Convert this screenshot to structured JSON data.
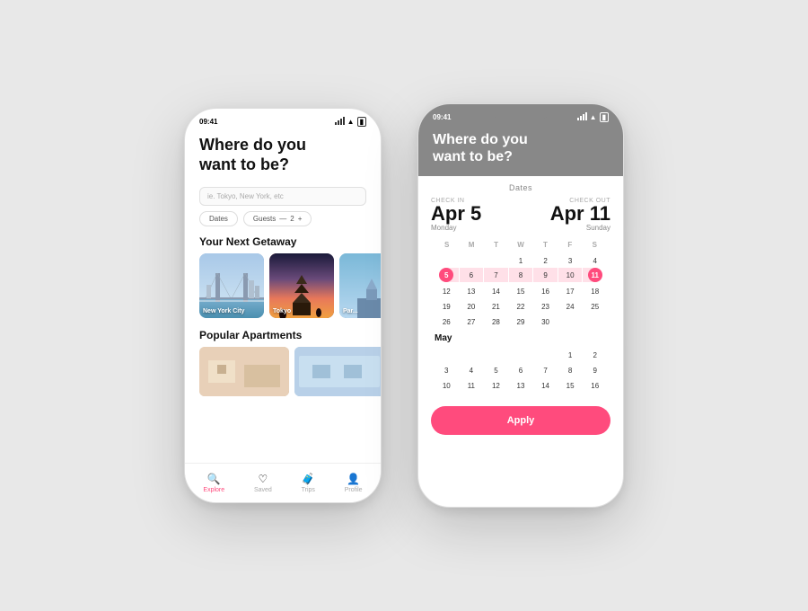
{
  "phones": {
    "left": {
      "status": {
        "time": "09:41",
        "signal": "signal-icon",
        "wifi": "wifi-icon",
        "battery": "battery-icon"
      },
      "header": {
        "title": "Where do you\nwant to be?"
      },
      "search": {
        "placeholder": "ie. Tokyo, New York, etc"
      },
      "filters": {
        "dates_label": "Dates",
        "guests_label": "Guests",
        "guests_value": "2",
        "guests_minus": "−",
        "guests_plus": "+"
      },
      "getaway": {
        "section_title": "Your Next Getaway",
        "cards": [
          {
            "label": "New York City",
            "style": "nyc"
          },
          {
            "label": "Tokyo",
            "style": "tokyo"
          },
          {
            "label": "Par...",
            "style": "paris"
          }
        ]
      },
      "apartments": {
        "section_title": "Popular Apartments"
      },
      "nav": {
        "items": [
          {
            "icon": "🔍",
            "label": "Explore",
            "active": true
          },
          {
            "icon": "♡",
            "label": "Saved",
            "active": false
          },
          {
            "icon": "🧳",
            "label": "Trips",
            "active": false
          },
          {
            "icon": "👤",
            "label": "Profile",
            "active": false
          }
        ]
      }
    },
    "right": {
      "status": {
        "time": "09:41"
      },
      "header": {
        "title": "Where do you\nwant to be?"
      },
      "dates_panel": {
        "title": "Dates",
        "checkin_label": "CHECK IN",
        "checkin_date": "Apr 5",
        "checkin_day": "Monday",
        "checkout_label": "CHECK OUT",
        "checkout_date": "Apr 11",
        "checkout_day": "Sunday"
      },
      "calendar": {
        "april": {
          "month_label": "",
          "days_of_week": [
            "S",
            "M",
            "T",
            "W",
            "T",
            "F",
            "S"
          ],
          "weeks": [
            [
              "",
              "",
              "",
              "1",
              "2",
              "3",
              "4"
            ],
            [
              "5",
              "6",
              "7",
              "8",
              "9",
              "10",
              "11"
            ],
            [
              "12",
              "13",
              "14",
              "15",
              "16",
              "17",
              "18"
            ],
            [
              "19",
              "20",
              "21",
              "22",
              "23",
              "24",
              "25"
            ],
            [
              "26",
              "27",
              "28",
              "29",
              "30",
              "",
              ""
            ]
          ],
          "selected_start": "5",
          "selected_end": "11",
          "in_range": [
            "6",
            "7",
            "8",
            "9",
            "10"
          ]
        },
        "may": {
          "month_label": "May",
          "weeks": [
            [
              "",
              "",
              "",
              "",
              "",
              "1",
              "2"
            ],
            [
              "3",
              "4",
              "5",
              "6",
              "7",
              "8",
              "9"
            ],
            [
              "10",
              "11",
              "12",
              "13",
              "14",
              "15",
              "16"
            ]
          ]
        }
      },
      "apply_button": "Apply"
    }
  }
}
